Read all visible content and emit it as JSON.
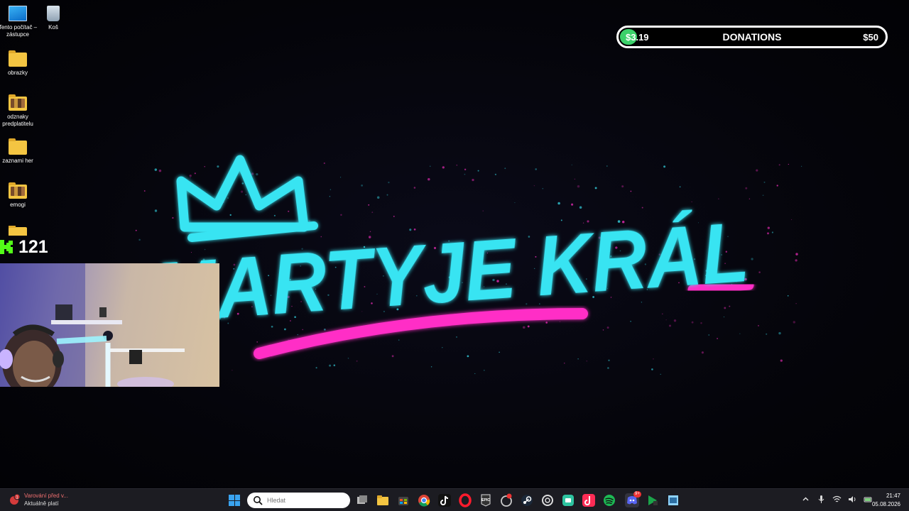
{
  "desktop_icons": [
    {
      "label": "Tento počítač – zástupce",
      "icon": "computer-icon"
    },
    {
      "label": "Koš",
      "icon": "recycle-bin-icon"
    },
    {
      "label": "obrazky",
      "icon": "folder-icon"
    },
    {
      "label": "odznaky predplatitelu",
      "icon": "folder-pictures-icon"
    },
    {
      "label": "zaznami her",
      "icon": "folder-icon"
    },
    {
      "label": "emogi",
      "icon": "folder-pictures-icon"
    },
    {
      "label": "",
      "icon": "folder-icon"
    }
  ],
  "donations": {
    "current": "$3.19",
    "label": "DONATIONS",
    "goal": "$50",
    "progress": 0.064,
    "fill_color": "#3cd16a"
  },
  "logo": {
    "text": "MARTYJE KRÁL",
    "primary_color": "#38e4f2",
    "accent_color": "#ff2fc6",
    "crown_icon": "crown-icon"
  },
  "kick": {
    "icon": "kick-logo-icon",
    "count": "121",
    "color": "#53fc18"
  },
  "webcam": {
    "icon": "webcam-feed"
  },
  "taskbar": {
    "notification": {
      "title": "Varování před v...",
      "subtitle": "Aktuálně platí",
      "badge": "1"
    },
    "search": {
      "placeholder": "Hledat"
    },
    "apps": [
      {
        "name": "task-view-icon"
      },
      {
        "name": "file-explorer-icon"
      },
      {
        "name": "microsoft-store-icon"
      },
      {
        "name": "chrome-icon"
      },
      {
        "name": "tiktok-icon"
      },
      {
        "name": "opera-icon"
      },
      {
        "name": "epic-games-icon"
      },
      {
        "name": "app-circle-icon"
      },
      {
        "name": "steam-icon"
      },
      {
        "name": "chatgpt-icon"
      },
      {
        "name": "app-green-icon"
      },
      {
        "name": "tiktok-live-icon"
      },
      {
        "name": "spotify-icon"
      },
      {
        "name": "discord-icon"
      },
      {
        "name": "app-arrow-icon"
      },
      {
        "name": "app-box-icon"
      }
    ],
    "discord_badge": "9+",
    "clock": {
      "time": "21:47",
      "date": "05.08.2026"
    }
  }
}
